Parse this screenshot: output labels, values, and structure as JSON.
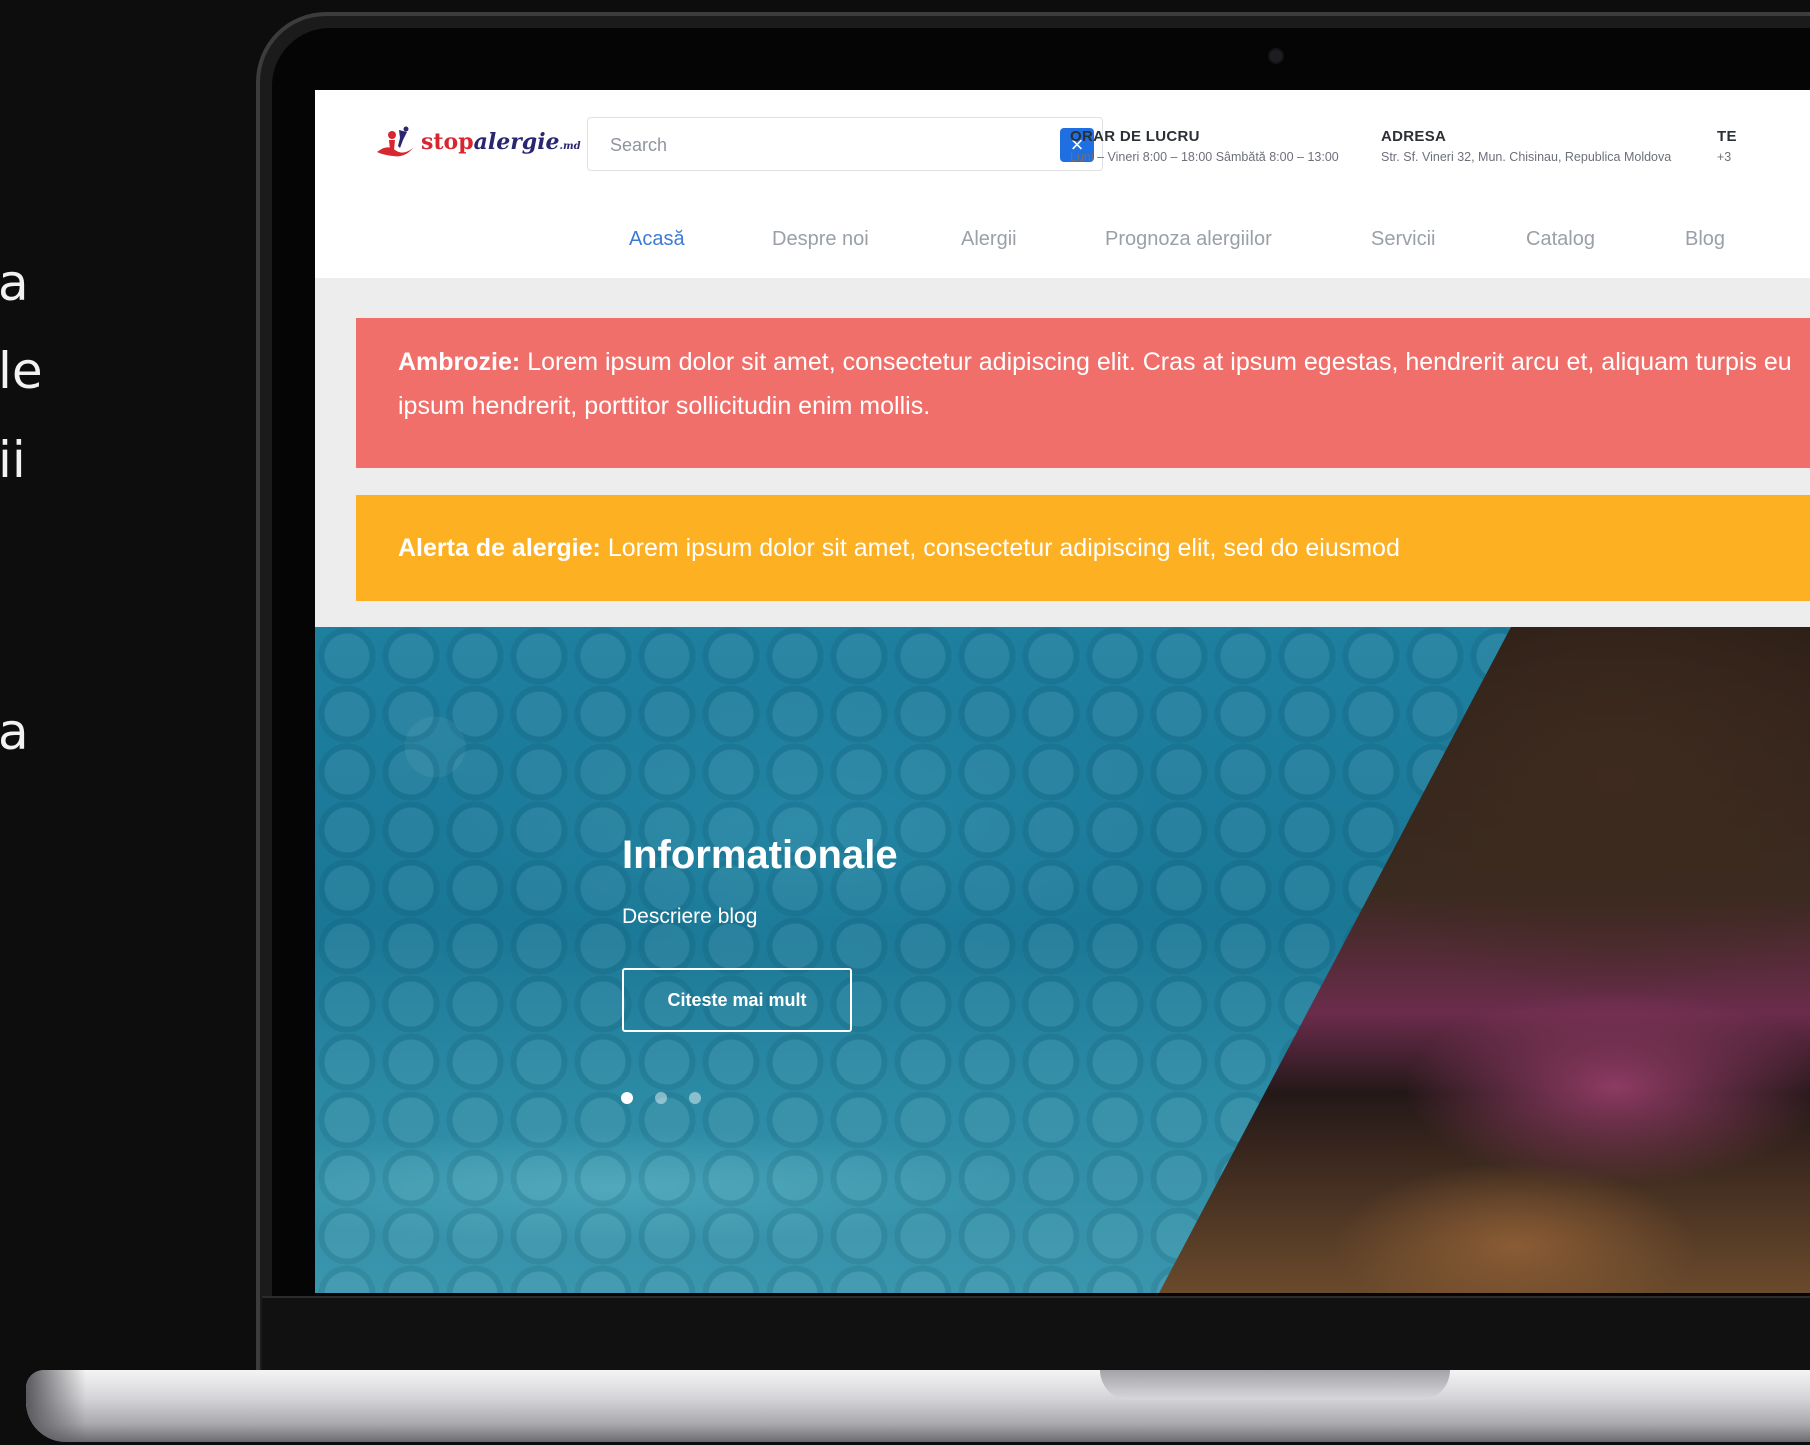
{
  "side_text": [
    "a",
    "le",
    "ii",
    "a"
  ],
  "header": {
    "logo": {
      "name": "stop",
      "name2": "alergie",
      "suffix": ".md"
    },
    "search": {
      "placeholder": "Search"
    },
    "hours": {
      "title": "ORAR DE LUCRU",
      "text": "Luni – Vineri 8:00 – 18:00 Sâmbătă 8:00 – 13:00"
    },
    "address": {
      "title": "ADRESA",
      "text": "Str. Sf. Vineri 32, Mun. Chisinau, Republica Moldova"
    },
    "phone": {
      "title": "TE",
      "text": "+3"
    }
  },
  "nav": {
    "items": [
      "Acasă",
      "Despre noi",
      "Alergii",
      "Prognoza alergiilor",
      "Servicii",
      "Catalog",
      "Blog"
    ],
    "active": "Acasă"
  },
  "alerts": {
    "red": {
      "label": "Ambrozie:",
      "text": "Lorem ipsum dolor sit amet, consectetur adipiscing elit. Cras at ipsum egestas, hendrerit arcu et, aliquam turpis eu ipsum hendrerit, porttitor sollicitudin enim mollis.",
      "color": "#f06f6a"
    },
    "orange": {
      "label": "Alerta de alergie:",
      "text": "Lorem ipsum dolor sit amet, consectetur adipiscing elit, sed do eiusmod",
      "color": "#fcb022"
    }
  },
  "hero": {
    "title": "Informationale",
    "subtitle": "Descriere blog",
    "button": "Citeste mai mult",
    "slides": 3,
    "active_slide": 1
  },
  "colors": {
    "accent": "#1f6fe0",
    "nav_active": "#3b7bd6"
  }
}
